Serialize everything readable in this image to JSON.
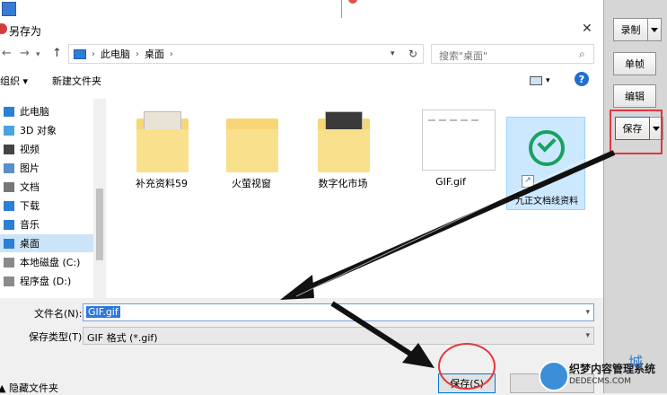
{
  "dialog": {
    "title": "另存为"
  },
  "address": {
    "pc": "此电脑",
    "folder": "桌面",
    "search_placeholder": "搜索\"桌面\""
  },
  "toolbar": {
    "organize": "组织 ▾",
    "new_folder": "新建文件夹"
  },
  "nav": [
    {
      "label": "此电脑",
      "icon": "pc-icon"
    },
    {
      "label": "3D 对象",
      "icon": "cube-icon"
    },
    {
      "label": "视频",
      "icon": "video-icon"
    },
    {
      "label": "图片",
      "icon": "picture-icon"
    },
    {
      "label": "文档",
      "icon": "document-icon"
    },
    {
      "label": "下载",
      "icon": "download-icon"
    },
    {
      "label": "音乐",
      "icon": "music-icon"
    },
    {
      "label": "桌面",
      "icon": "desktop-icon",
      "selected": true
    },
    {
      "label": "本地磁盘 (C:)",
      "icon": "drive-icon"
    },
    {
      "label": "程序盘 (D:)",
      "icon": "drive-icon"
    }
  ],
  "files": [
    {
      "label": "补充资料59",
      "type": "folder"
    },
    {
      "label": "火萤视窗",
      "type": "folder"
    },
    {
      "label": "数字化市场",
      "type": "folder"
    },
    {
      "label": "GIF.gif",
      "type": "gif"
    },
    {
      "label": "九正文档线资料",
      "type": "shortcut",
      "selected": true
    }
  ],
  "form": {
    "filename_label": "文件名(N):",
    "filename_value": "GIF.gif",
    "filetype_label": "保存类型(T):",
    "filetype_value": "GIF 格式 (*.gif)",
    "hide_folders": "▲ 隐藏文件夹",
    "save": "保存(S)"
  },
  "side_panel": {
    "record": "录制",
    "single_frame": "单帧",
    "edit": "编辑",
    "save": "保存"
  },
  "watermark": {
    "line1": "织梦内容管理系统",
    "line2": "DEDECMS.COM",
    "mark": "城"
  },
  "colors": {
    "highlight": "#e0383e",
    "selection": "#cce4f7",
    "accent": "#0078d7"
  }
}
